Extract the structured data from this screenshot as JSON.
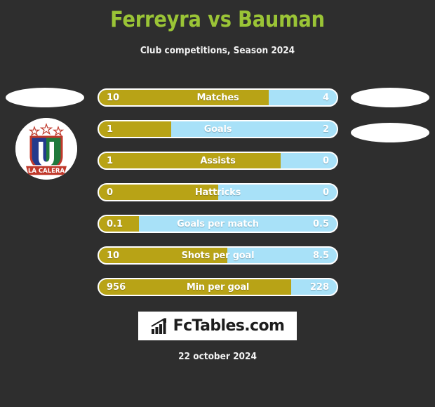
{
  "header": {
    "title": "Ferreyra vs Bauman",
    "subtitle": "Club competitions, Season 2024",
    "title_color": "#9ac436",
    "subtitle_color": "#f2f2f2"
  },
  "colors": {
    "background": "#2e2e2e",
    "home_bar": "#b8a316",
    "away_bar": "#a8e1f8",
    "bar_border": "#ffffff",
    "value_text": "#ffffff"
  },
  "home_club": {
    "badge_name": "union-la-calera-crest",
    "badge_text": "LA CALERA",
    "stars": 3
  },
  "logo_slots": {
    "home_top": "",
    "away_top": "",
    "away_bottom": ""
  },
  "chart_data": {
    "type": "bar",
    "title": "Ferreyra vs Bauman",
    "subtitle": "Club competitions, Season 2024",
    "xlabel": "",
    "ylabel": "",
    "legend": [
      "Ferreyra",
      "Bauman"
    ],
    "legend_position": "none",
    "grid": false,
    "categories": [
      "Matches",
      "Goals",
      "Assists",
      "Hattricks",
      "Goals per match",
      "Shots per goal",
      "Min per goal"
    ],
    "series": [
      {
        "name": "Ferreyra",
        "color": "#b8a316",
        "values": [
          10,
          1,
          1,
          0,
          0.1,
          10,
          956
        ]
      },
      {
        "name": "Bauman",
        "color": "#a8e1f8",
        "values": [
          4,
          2,
          0,
          0,
          0.5,
          8.5,
          228
        ]
      }
    ]
  },
  "stats": [
    {
      "label": "Matches",
      "home_value": "10",
      "away_value": "4",
      "home_pct": 71.4
    },
    {
      "label": "Goals",
      "home_value": "1",
      "away_value": "2",
      "home_pct": 30.5
    },
    {
      "label": "Assists",
      "home_value": "1",
      "away_value": "0",
      "home_pct": 76.5
    },
    {
      "label": "Hattricks",
      "home_value": "0",
      "away_value": "0",
      "home_pct": 50
    },
    {
      "label": "Goals per match",
      "home_value": "0.1",
      "away_value": "0.5",
      "home_pct": 16.7
    },
    {
      "label": "Shots per goal",
      "home_value": "10",
      "away_value": "8.5",
      "home_pct": 54.1
    },
    {
      "label": "Min per goal",
      "home_value": "956",
      "away_value": "228",
      "home_pct": 80.7
    }
  ],
  "watermark": {
    "text": "FcTables.com",
    "icon": "bar-chart-growth-icon"
  },
  "footer": {
    "date": "22 october 2024"
  }
}
